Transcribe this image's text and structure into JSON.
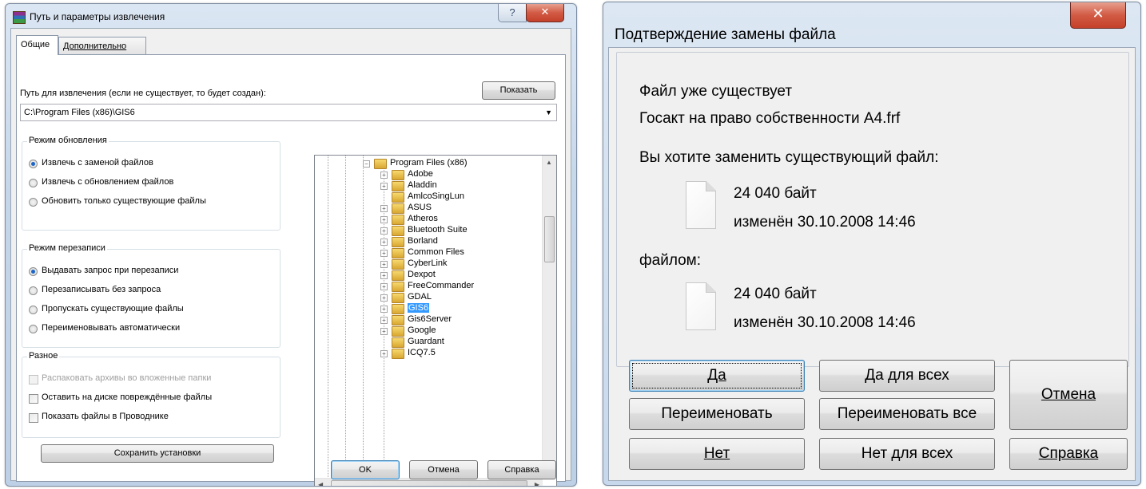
{
  "left_window": {
    "title": "Путь и параметры извлечения",
    "tabs": [
      "Общие",
      "Дополнительно"
    ],
    "path_label": "Путь для извлечения (если не существует, то будет создан):",
    "show_button": "Показать",
    "path_value": "C:\\Program Files (x86)\\GIS6",
    "update_mode": {
      "title": "Режим обновления",
      "options": [
        "Извлечь с заменой файлов",
        "Извлечь с обновлением файлов",
        "Обновить только существующие файлы"
      ],
      "selected": 0
    },
    "overwrite_mode": {
      "title": "Режим перезаписи",
      "options": [
        "Выдавать запрос при перезаписи",
        "Перезаписывать без запроса",
        "Пропускать существующие файлы",
        "Переименовывать автоматически"
      ],
      "selected": 0
    },
    "misc": {
      "title": "Разное",
      "options": [
        "Распаковать архивы во вложенные папки",
        "Оставить на диске повреждённые файлы",
        "Показать файлы в Проводнике"
      ]
    },
    "save_button": "Сохранить установки",
    "tree": {
      "root": "Program Files (x86)",
      "items": [
        "Adobe",
        "Aladdin",
        "AmlcoSingLun",
        "ASUS",
        "Atheros",
        "Bluetooth Suite",
        "Borland",
        "Common Files",
        "CyberLink",
        "Dexpot",
        "FreeCommander",
        "GDAL",
        "GIS6",
        "Gis6Server",
        "Google",
        "Guardant",
        "ICQ7.5"
      ],
      "selected": "GIS6"
    },
    "ok_button": "OK",
    "cancel_button": "Отмена",
    "help_button": "Справка"
  },
  "right_window": {
    "title": "Подтверждение замены файла",
    "line1": "Файл уже существует",
    "line2": "Госакт на право собственности А4.frf",
    "question": "Вы хотите заменить существующий файл:",
    "existing_size": "24 040 байт",
    "existing_date": "изменён 30.10.2008 14:46",
    "with_label": "файлом:",
    "new_size": "24 040 байт",
    "new_date": "изменён 30.10.2008 14:46",
    "buttons": {
      "yes": "Да",
      "yes_all": "Да для всех",
      "cancel": "Отмена",
      "rename": "Переименовать",
      "rename_all": "Переименовать все",
      "no": "Нет",
      "no_all": "Нет для всех",
      "help": "Справка"
    }
  }
}
